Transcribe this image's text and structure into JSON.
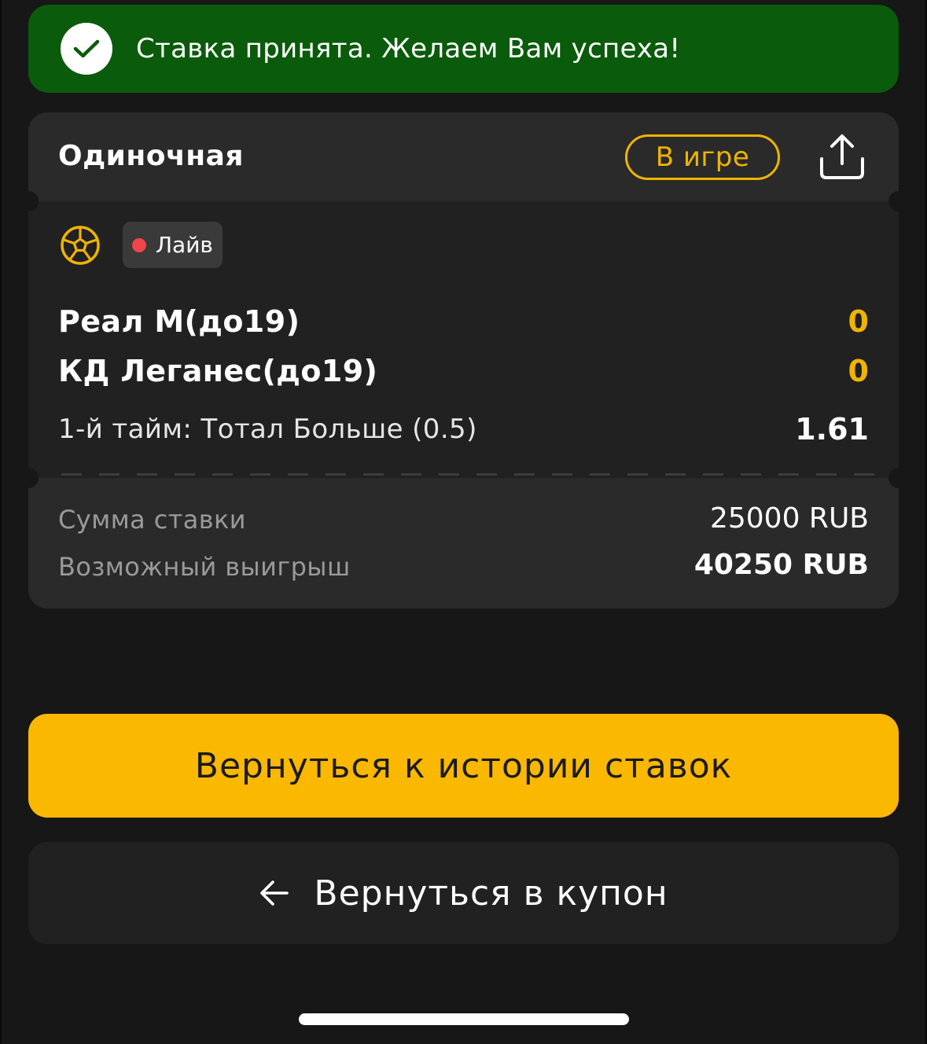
{
  "toast": {
    "message": "Ставка принята. Желаем Вам успеха!",
    "icon": "check-icon",
    "color": "#0a5b0b"
  },
  "bet": {
    "type_label": "Одиночная",
    "status_label": "В игре",
    "status_color": "#f0b400",
    "share_icon": "share-icon",
    "sport_icon": "soccer-ball-icon",
    "live_label": "Лайв",
    "live_dot_color": "#f0454a",
    "teams": [
      {
        "name": "Реал М(до19)",
        "score": "0"
      },
      {
        "name": "КД Леганес(до19)",
        "score": "0"
      }
    ],
    "market": "1-й тайм: Тотал Больше (0.5)",
    "odds": "1.61",
    "stake_label": "Сумма ставки",
    "stake_value": "25000 RUB",
    "payout_label": "Возможный выигрыш",
    "payout_value": "40250 RUB"
  },
  "actions": {
    "history_label": "Вернуться к истории ставок",
    "history_color": "#fbb800",
    "coupon_label": "Вернуться в купон",
    "coupon_icon": "arrow-left-icon"
  }
}
